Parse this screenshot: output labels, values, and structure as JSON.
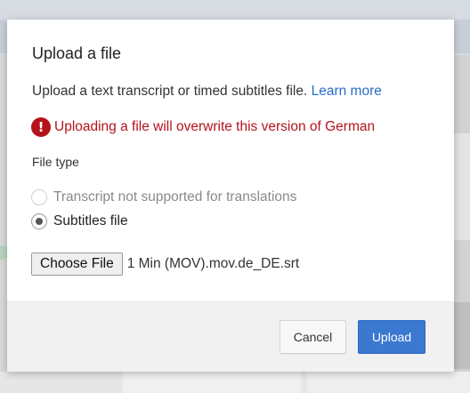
{
  "dialog": {
    "title": "Upload a file",
    "description": "Upload a text transcript or timed subtitles file.",
    "learn_more": "Learn more",
    "warning": {
      "icon": "alert-circle-icon",
      "text": "Uploading a file will overwrite this version of German"
    },
    "file_type_label": "File type",
    "options": [
      {
        "label": "Transcript not supported for translations",
        "selected": false,
        "disabled": true
      },
      {
        "label": "Subtitles file",
        "selected": true,
        "disabled": false
      }
    ],
    "choose_file_label": "Choose File",
    "file_name": "1 Min (MOV).mov.de_DE.srt",
    "cancel_label": "Cancel",
    "upload_label": "Upload"
  },
  "colors": {
    "accent": "#3b78d0",
    "link": "#2a6dc4",
    "error": "#b5131b"
  }
}
